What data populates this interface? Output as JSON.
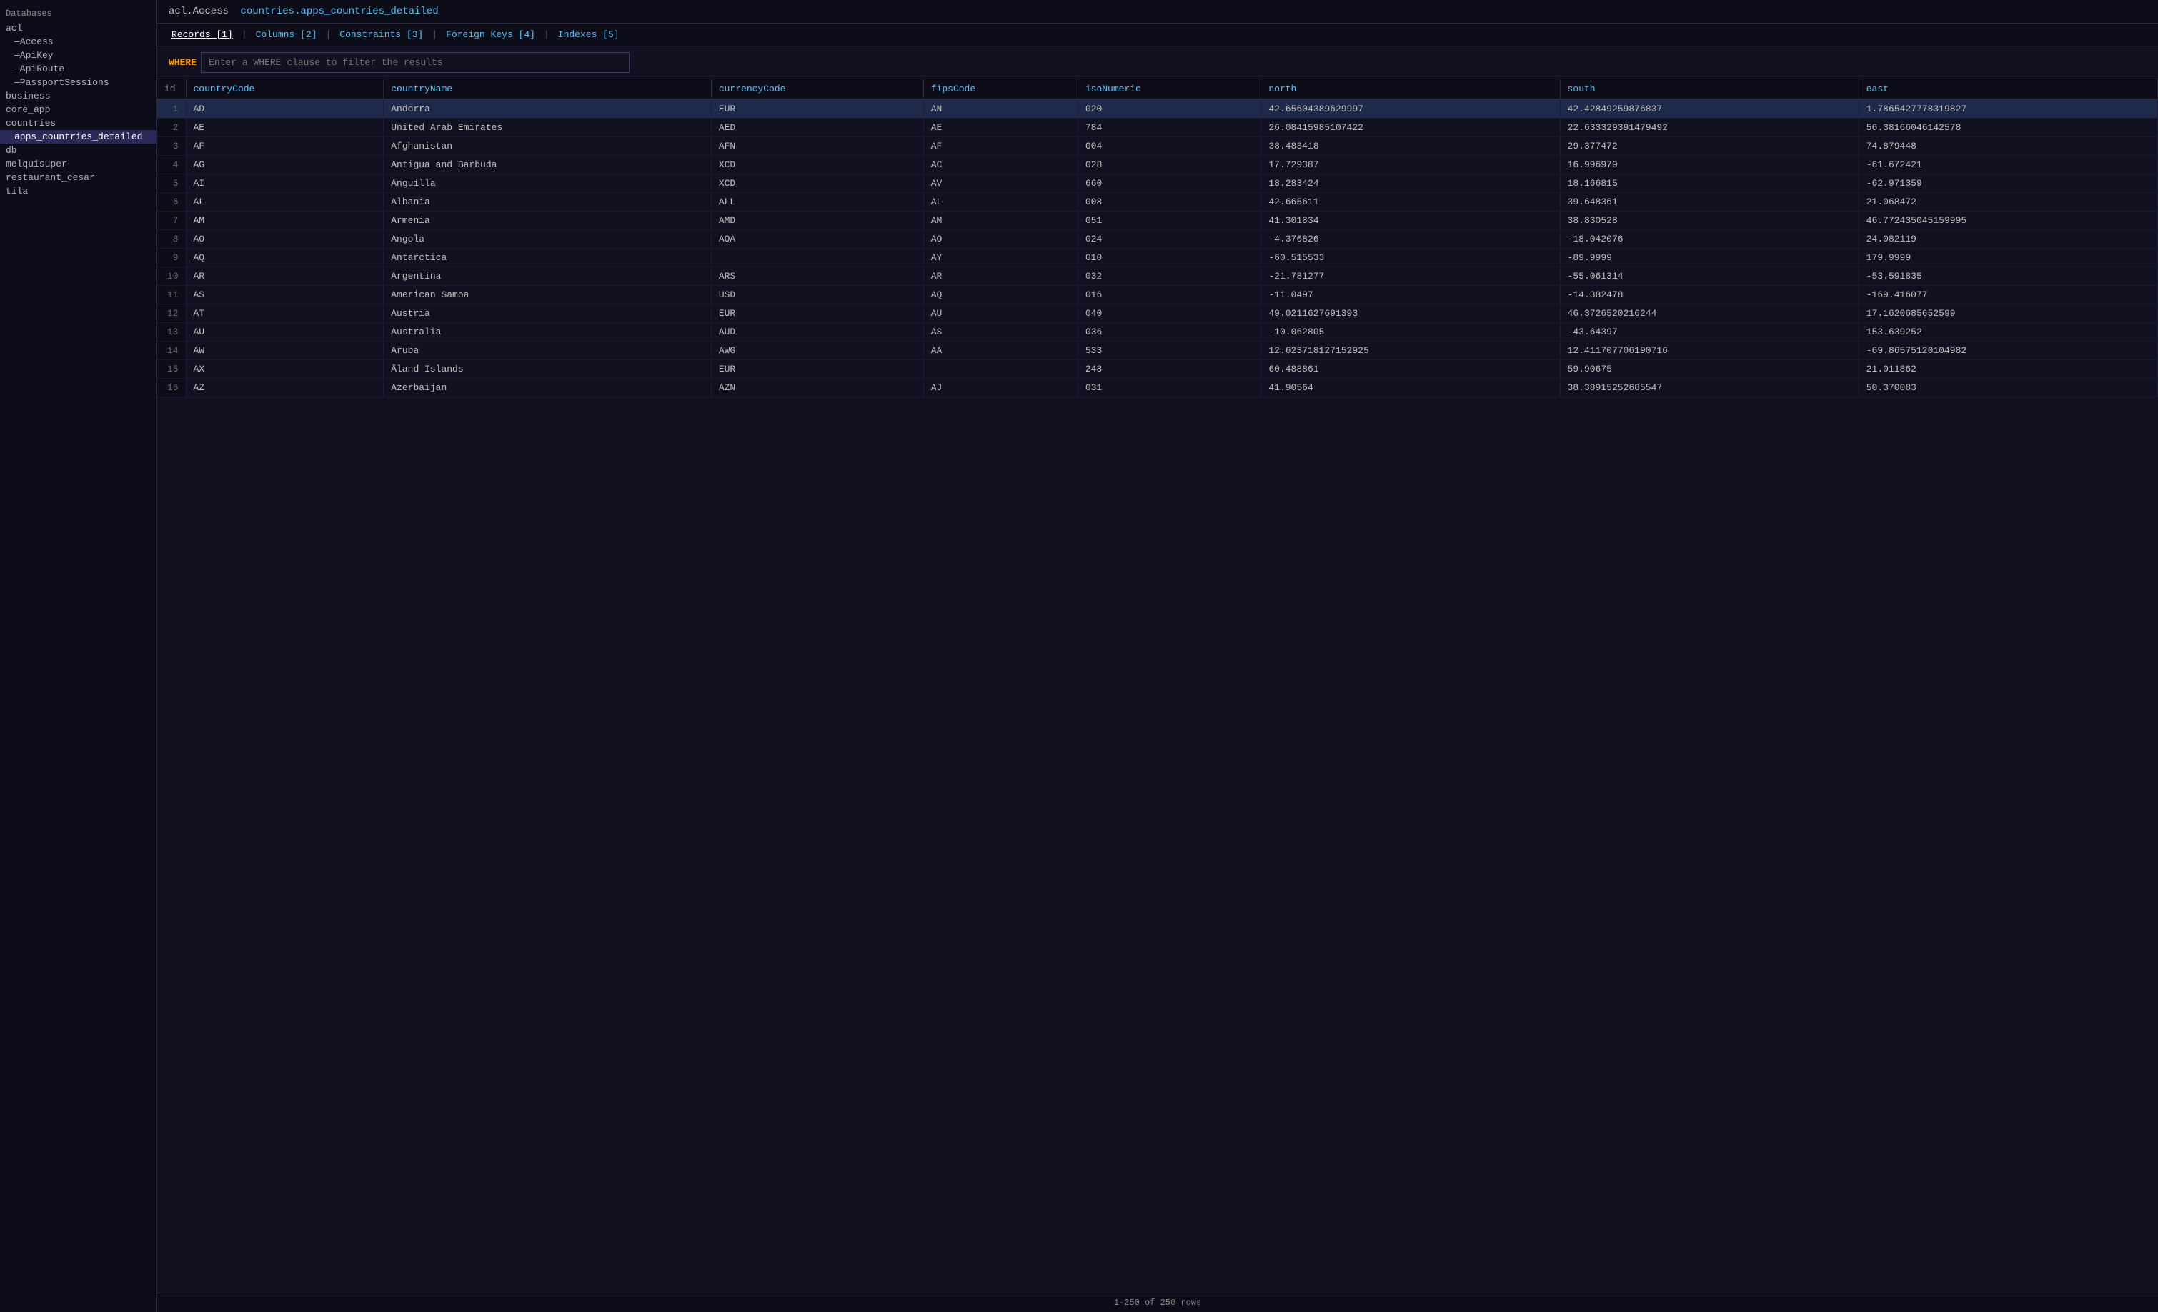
{
  "sidebar": {
    "header": "Databases",
    "items": [
      {
        "label": "acl",
        "indent": 0,
        "id": "acl"
      },
      {
        "label": "—Access",
        "indent": 1,
        "id": "acl-access"
      },
      {
        "label": "—ApiKey",
        "indent": 1,
        "id": "acl-apikey"
      },
      {
        "label": "—ApiRoute",
        "indent": 1,
        "id": "acl-apiroute"
      },
      {
        "label": "—PassportSessions",
        "indent": 1,
        "id": "acl-passportsessions"
      },
      {
        "label": "business",
        "indent": 0,
        "id": "business"
      },
      {
        "label": "core_app",
        "indent": 0,
        "id": "core_app"
      },
      {
        "label": "countries",
        "indent": 0,
        "id": "countries"
      },
      {
        "label": "apps_countries_detailed",
        "indent": 1,
        "id": "apps-countries-detailed",
        "selected": true
      },
      {
        "label": "db",
        "indent": 0,
        "id": "db"
      },
      {
        "label": "melquisuper",
        "indent": 0,
        "id": "melquisuper"
      },
      {
        "label": "restaurant_cesar",
        "indent": 0,
        "id": "restaurant-cesar"
      },
      {
        "label": "tila",
        "indent": 0,
        "id": "tila"
      }
    ]
  },
  "breadcrumb": {
    "db": "acl.Access",
    "table": "countries.apps_countries_detailed"
  },
  "tabs": [
    {
      "label": "Records [1]",
      "id": "tab-records",
      "active": true
    },
    {
      "label": "Columns [2]",
      "id": "tab-columns",
      "active": false
    },
    {
      "label": "Constraints [3]",
      "id": "tab-constraints",
      "active": false
    },
    {
      "label": "Foreign Keys [4]",
      "id": "tab-foreignkeys",
      "active": false
    },
    {
      "label": "Indexes [5]",
      "id": "tab-indexes",
      "active": false
    }
  ],
  "filter": {
    "keyword": "WHERE",
    "placeholder": "Enter a WHERE clause to filter the results"
  },
  "table": {
    "columns": [
      "id",
      "countryCode",
      "countryName",
      "currencyCode",
      "fipsCode",
      "isoNumeric",
      "north",
      "south",
      "east"
    ],
    "rows": [
      {
        "id": 1,
        "countryCode": "AD",
        "countryName": "Andorra",
        "currencyCode": "EUR",
        "fipsCode": "AN",
        "isoNumeric": "020",
        "north": "42.65604389629997",
        "south": "42.42849259876837",
        "east": "1.7865427778319827"
      },
      {
        "id": 2,
        "countryCode": "AE",
        "countryName": "United Arab Emirates",
        "currencyCode": "AED",
        "fipsCode": "AE",
        "isoNumeric": "784",
        "north": "26.08415985107422",
        "south": "22.633329391479492",
        "east": "56.38166046142578"
      },
      {
        "id": 3,
        "countryCode": "AF",
        "countryName": "Afghanistan",
        "currencyCode": "AFN",
        "fipsCode": "AF",
        "isoNumeric": "004",
        "north": "38.483418",
        "south": "29.377472",
        "east": "74.879448"
      },
      {
        "id": 4,
        "countryCode": "AG",
        "countryName": "Antigua and Barbuda",
        "currencyCode": "XCD",
        "fipsCode": "AC",
        "isoNumeric": "028",
        "north": "17.729387",
        "south": "16.996979",
        "east": "-61.672421"
      },
      {
        "id": 5,
        "countryCode": "AI",
        "countryName": "Anguilla",
        "currencyCode": "XCD",
        "fipsCode": "AV",
        "isoNumeric": "660",
        "north": "18.283424",
        "south": "18.166815",
        "east": "-62.971359"
      },
      {
        "id": 6,
        "countryCode": "AL",
        "countryName": "Albania",
        "currencyCode": "ALL",
        "fipsCode": "AL",
        "isoNumeric": "008",
        "north": "42.665611",
        "south": "39.648361",
        "east": "21.068472"
      },
      {
        "id": 7,
        "countryCode": "AM",
        "countryName": "Armenia",
        "currencyCode": "AMD",
        "fipsCode": "AM",
        "isoNumeric": "051",
        "north": "41.301834",
        "south": "38.830528",
        "east": "46.772435045159995"
      },
      {
        "id": 8,
        "countryCode": "AO",
        "countryName": "Angola",
        "currencyCode": "AOA",
        "fipsCode": "AO",
        "isoNumeric": "024",
        "north": "-4.376826",
        "south": "-18.042076",
        "east": "24.082119"
      },
      {
        "id": 9,
        "countryCode": "AQ",
        "countryName": "Antarctica",
        "currencyCode": "",
        "fipsCode": "AY",
        "isoNumeric": "010",
        "north": "-60.515533",
        "south": "-89.9999",
        "east": "179.9999"
      },
      {
        "id": 10,
        "countryCode": "AR",
        "countryName": "Argentina",
        "currencyCode": "ARS",
        "fipsCode": "AR",
        "isoNumeric": "032",
        "north": "-21.781277",
        "south": "-55.061314",
        "east": "-53.591835"
      },
      {
        "id": 11,
        "countryCode": "AS",
        "countryName": "American Samoa",
        "currencyCode": "USD",
        "fipsCode": "AQ",
        "isoNumeric": "016",
        "north": "-11.0497",
        "south": "-14.382478",
        "east": "-169.416077"
      },
      {
        "id": 12,
        "countryCode": "AT",
        "countryName": "Austria",
        "currencyCode": "EUR",
        "fipsCode": "AU",
        "isoNumeric": "040",
        "north": "49.0211627691393",
        "south": "46.3726520216244",
        "east": "17.1620685652599"
      },
      {
        "id": 13,
        "countryCode": "AU",
        "countryName": "Australia",
        "currencyCode": "AUD",
        "fipsCode": "AS",
        "isoNumeric": "036",
        "north": "-10.062805",
        "south": "-43.64397",
        "east": "153.639252"
      },
      {
        "id": 14,
        "countryCode": "AW",
        "countryName": "Aruba",
        "currencyCode": "AWG",
        "fipsCode": "AA",
        "isoNumeric": "533",
        "north": "12.623718127152925",
        "south": "12.411707706190716",
        "east": "-69.86575120104982"
      },
      {
        "id": 15,
        "countryCode": "AX",
        "countryName": "Åland Islands",
        "currencyCode": "EUR",
        "fipsCode": "",
        "isoNumeric": "248",
        "north": "60.488861",
        "south": "59.90675",
        "east": "21.011862"
      },
      {
        "id": 16,
        "countryCode": "AZ",
        "countryName": "Azerbaijan",
        "currencyCode": "AZN",
        "fipsCode": "AJ",
        "isoNumeric": "031",
        "north": "41.90564",
        "south": "38.38915252685547",
        "east": "50.370083"
      }
    ]
  },
  "footer": {
    "pagination": "1-250 of 250 rows"
  }
}
